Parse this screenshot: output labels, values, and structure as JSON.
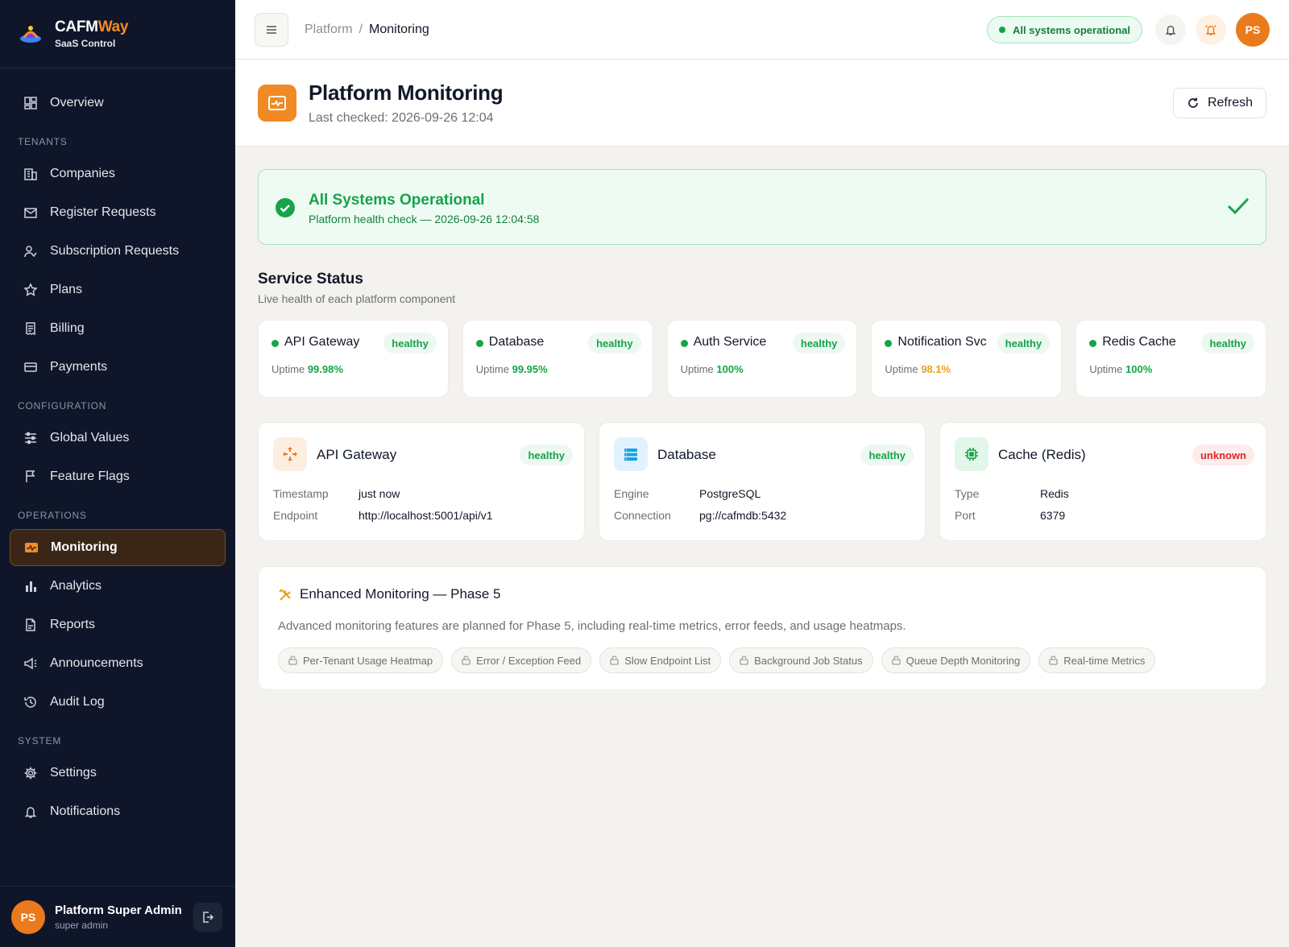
{
  "brand": {
    "name_main": "CAFM",
    "name_accent": "Way",
    "subtitle": "SaaS Control"
  },
  "sidebar": {
    "overview": "Overview",
    "sections": {
      "tenants": "TENANTS",
      "configuration": "CONFIGURATION",
      "operations": "OPERATIONS",
      "system": "SYSTEM"
    },
    "items": {
      "companies": "Companies",
      "register_requests": "Register Requests",
      "subscription_requests": "Subscription Requests",
      "plans": "Plans",
      "billing": "Billing",
      "payments": "Payments",
      "global_values": "Global Values",
      "feature_flags": "Feature Flags",
      "monitoring": "Monitoring",
      "analytics": "Analytics",
      "reports": "Reports",
      "announcements": "Announcements",
      "audit_log": "Audit Log",
      "settings": "Settings",
      "notifications": "Notifications"
    },
    "user": {
      "initials": "PS",
      "name": "Platform Super Admin",
      "role": "super admin"
    }
  },
  "topbar": {
    "breadcrumb": {
      "root": "Platform",
      "separator": "/",
      "current": "Monitoring"
    },
    "status": "All systems operational",
    "avatar_initials": "PS"
  },
  "page": {
    "title": "Platform Monitoring",
    "last_checked": "Last checked: 2026-09-26 12:04",
    "refresh_label": "Refresh"
  },
  "banner": {
    "title": "All Systems Operational",
    "subtitle": "Platform health check — 2026-09-26 12:04:58"
  },
  "service_status": {
    "title": "Service Status",
    "subtitle": "Live health of each platform component",
    "uptime_label": "Uptime",
    "services": [
      {
        "name": "API Gateway",
        "status": "healthy",
        "uptime": "99.98%"
      },
      {
        "name": "Database",
        "status": "healthy",
        "uptime": "99.95%"
      },
      {
        "name": "Auth Service",
        "status": "healthy",
        "uptime": "100%"
      },
      {
        "name": "Notification Svc",
        "status": "healthy",
        "uptime": "98.1%"
      },
      {
        "name": "Redis Cache",
        "status": "healthy",
        "uptime": "100%"
      }
    ]
  },
  "details": [
    {
      "title": "API Gateway",
      "status": "healthy",
      "rows": [
        {
          "k": "Timestamp",
          "v": "just now"
        },
        {
          "k": "Endpoint",
          "v": "http://localhost:5001/api/v1"
        }
      ]
    },
    {
      "title": "Database",
      "status": "healthy",
      "rows": [
        {
          "k": "Engine",
          "v": "PostgreSQL"
        },
        {
          "k": "Connection",
          "v": "pg://cafmdb:5432"
        }
      ]
    },
    {
      "title": "Cache (Redis)",
      "status": "unknown",
      "rows": [
        {
          "k": "Type",
          "v": "Redis"
        },
        {
          "k": "Port",
          "v": "6379"
        }
      ]
    }
  ],
  "enhanced": {
    "title": "Enhanced Monitoring — Phase 5",
    "description": "Advanced monitoring features are planned for Phase 5, including real-time metrics, error feeds, and usage heatmaps.",
    "chips": [
      "Per-Tenant Usage Heatmap",
      "Error / Exception Feed",
      "Slow Endpoint List",
      "Background Job Status",
      "Queue Depth Monitoring",
      "Real-time Metrics"
    ]
  },
  "colors": {
    "accent": "#f08a24",
    "sidebar_bg": "#0f1629",
    "healthy": "#16a34a",
    "warning": "#e8a317",
    "unknown": "#dc2626"
  }
}
